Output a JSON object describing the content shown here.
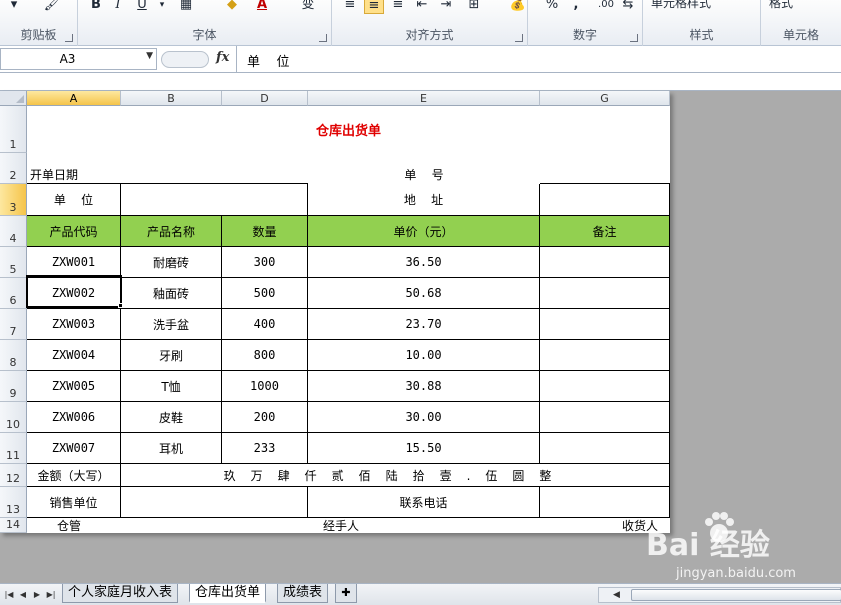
{
  "ribbon": {
    "groups": [
      {
        "label": "剪贴板"
      },
      {
        "label": "字体"
      },
      {
        "label": "对齐方式"
      },
      {
        "label": "数字"
      },
      {
        "label": "样式"
      },
      {
        "label": "单元格"
      }
    ],
    "font_buttons": {
      "bold": "B",
      "italic": "I",
      "underline": "U",
      "font_color": "A",
      "wen": "变"
    },
    "number_buttons": {
      "percent": "%",
      "comma": ",",
      "decimals": ".00"
    },
    "styles_label": "单元格样式",
    "cells_label": "格式"
  },
  "formula_bar": {
    "name_box": "A3",
    "fx": "fx",
    "content": "单    位"
  },
  "columns": [
    "A",
    "B",
    "D",
    "E",
    "G"
  ],
  "rows": [
    "1",
    "2",
    "3",
    "4",
    "5",
    "6",
    "7",
    "8",
    "9",
    "10",
    "11",
    "12",
    "13",
    "14"
  ],
  "sheet": {
    "title": "仓库出货单",
    "date_label": "开单日期",
    "number_label": "单    号",
    "unit_label": "单    位",
    "address_label": "地    址",
    "headers": [
      "产品代码",
      "产品名称",
      "数量",
      "单价（元）",
      "备注"
    ],
    "items": [
      {
        "code": "ZXW001",
        "name": "耐磨砖",
        "qty": "300",
        "price": "36.50"
      },
      {
        "code": "ZXW002",
        "name": "釉面砖",
        "qty": "500",
        "price": "50.68"
      },
      {
        "code": "ZXW003",
        "name": "洗手盆",
        "qty": "400",
        "price": "23.70"
      },
      {
        "code": "ZXW004",
        "name": "牙刷",
        "qty": "800",
        "price": "10.00"
      },
      {
        "code": "ZXW005",
        "name": "T恤",
        "qty": "1000",
        "price": "30.88"
      },
      {
        "code": "ZXW006",
        "name": "皮鞋",
        "qty": "200",
        "price": "30.00"
      },
      {
        "code": "ZXW007",
        "name": "耳机",
        "qty": "233",
        "price": "15.50"
      }
    ],
    "amount_label": "金额（大写）",
    "amount_value": "玖万肆仟贰佰陆拾壹.伍圆整",
    "seller_label": "销售单位",
    "phone_label": "联系电话",
    "warehouse_label": "仓管",
    "handler_label": "经手人",
    "receiver_label": "收货人"
  },
  "tabs": [
    {
      "label": "个人家庭月收入表"
    },
    {
      "label": "仓库出货单"
    },
    {
      "label": "成绩表"
    }
  ],
  "watermark": {
    "logo": "Bai  经验",
    "url": "jingyan.baidu.com"
  }
}
